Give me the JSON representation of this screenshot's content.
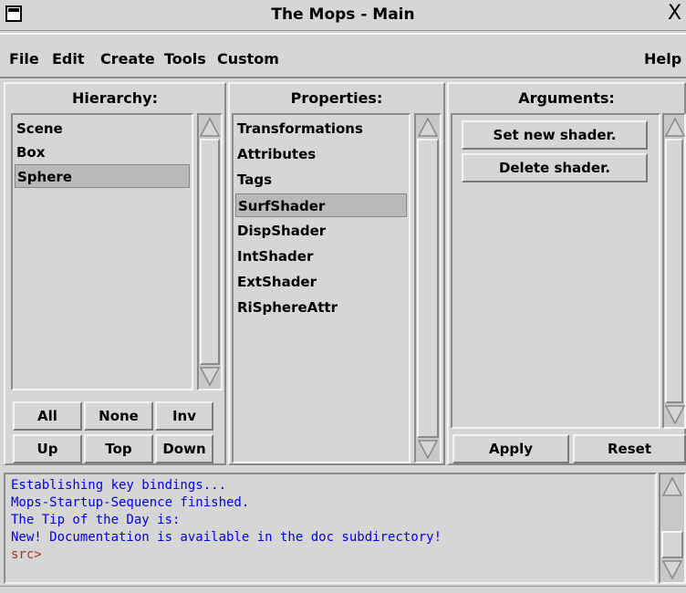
{
  "window": {
    "title": "The Mops - Main",
    "close_glyph": "X"
  },
  "menubar": {
    "items": [
      "File",
      "Edit",
      "Create",
      "Tools",
      "Custom"
    ],
    "help": "Help"
  },
  "hierarchy": {
    "title": "Hierarchy:",
    "items": [
      "Scene",
      "Box",
      "Sphere"
    ],
    "selected": "Sphere",
    "buttons": [
      "All",
      "None",
      "Inv",
      "Up",
      "Top",
      "Down"
    ]
  },
  "properties": {
    "title": "Properties:",
    "items": [
      "Transformations",
      "Attributes",
      "Tags",
      "SurfShader",
      "DispShader",
      "IntShader",
      "ExtShader",
      "RiSphereAttr"
    ],
    "selected": "SurfShader"
  },
  "arguments": {
    "title": "Arguments:",
    "set_shader": "Set new shader.",
    "delete_shader": "Delete shader.",
    "apply": "Apply",
    "reset": "Reset"
  },
  "console": {
    "lines": [
      "Establishing key bindings...",
      "Mops-Startup-Sequence finished.",
      "The Tip of the Day is:",
      "New! Documentation is available in the doc subdirectory!"
    ],
    "prompt": "src>",
    "text_color": "#0000ee",
    "prompt_color": "#aa3322"
  },
  "icons": {
    "window_menu": "window-menu-icon",
    "scroll_up": "arrow-up-icon",
    "scroll_down": "arrow-down-icon"
  }
}
